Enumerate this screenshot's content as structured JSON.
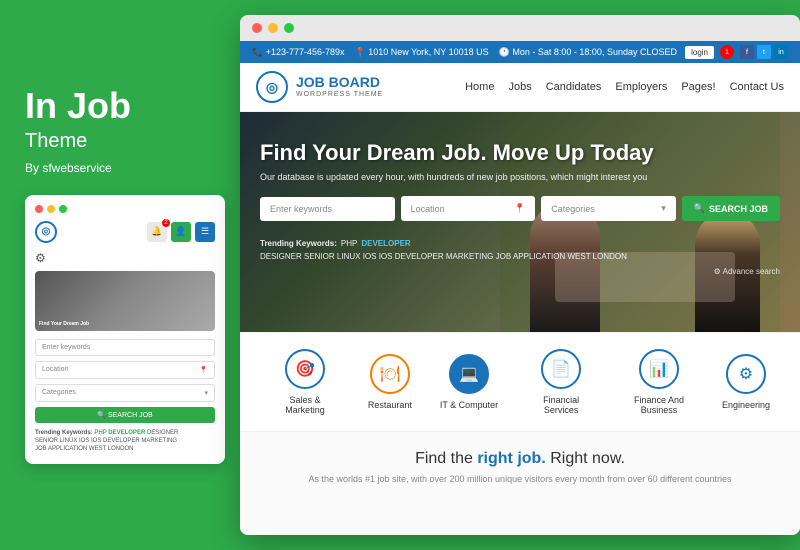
{
  "left": {
    "title": "In Job",
    "subtitle": "Theme",
    "author": "By sfwebservice",
    "mini": {
      "keywords_placeholder": "Enter keywords",
      "location_placeholder": "Location",
      "categories_placeholder": "Categories",
      "search_btn": "SEARCH JOB",
      "trending_label": "Trending Keywords:",
      "trending_keywords": "PHP  DEVELOPER  DESIGNER  SENIOR  LINUX  IOS  IOS DEVELOPER  MARKETING  JOB APPLICATION  WEST LONDON"
    }
  },
  "site": {
    "topbar": {
      "phone": "+123-777-456-789x",
      "address": "1010 New York, NY 10018 US",
      "hours": "Mon - Sat 8:00 - 18:00, Sunday CLOSED",
      "login": "login",
      "notif": "1"
    },
    "navbar": {
      "logo_text": "JOB BOARD",
      "logo_sub": "WORDPRESS THEME",
      "nav_items": [
        "Home",
        "Jobs",
        "Candidates",
        "Employers",
        "Pages!",
        "Contact Us"
      ]
    },
    "hero": {
      "title": "Find Your Dream Job. Move Up Today",
      "subtitle": "Our database is updated every hour, with hundreds of new job positions, which might interest you",
      "keywords_placeholder": "Enter keywords",
      "location_placeholder": "Location",
      "categories_placeholder": "Categories",
      "search_btn": "SEARCH JOB",
      "trending_label": "Trending Keywords:",
      "trending_keywords": "PHP  DEVELOPER  DESIGNER  SENIOR  LINUX  IOS  IOS DEVELOPER  MARKETING  JOB APPLICATION  WEST LONDON",
      "advance": "⚙ Advance search"
    },
    "categories": [
      {
        "label": "Sales & Marketing",
        "icon": "🎯",
        "style": ""
      },
      {
        "label": "Restaurant",
        "icon": "🍽",
        "style": "orange"
      },
      {
        "label": "IT & Computer",
        "icon": "💻",
        "style": "active"
      },
      {
        "label": "Financial Services",
        "icon": "📄",
        "style": ""
      },
      {
        "label": "Finance And Business",
        "icon": "📊",
        "style": ""
      },
      {
        "label": "Engineering",
        "icon": "⚙",
        "style": ""
      }
    ],
    "bottom": {
      "title_start": "Find the ",
      "title_strong": "right job.",
      "title_end": " Right now.",
      "subtitle": "As the worlds #1 job site, with over 200 million unique visitors every month from over 60 different countries"
    }
  }
}
